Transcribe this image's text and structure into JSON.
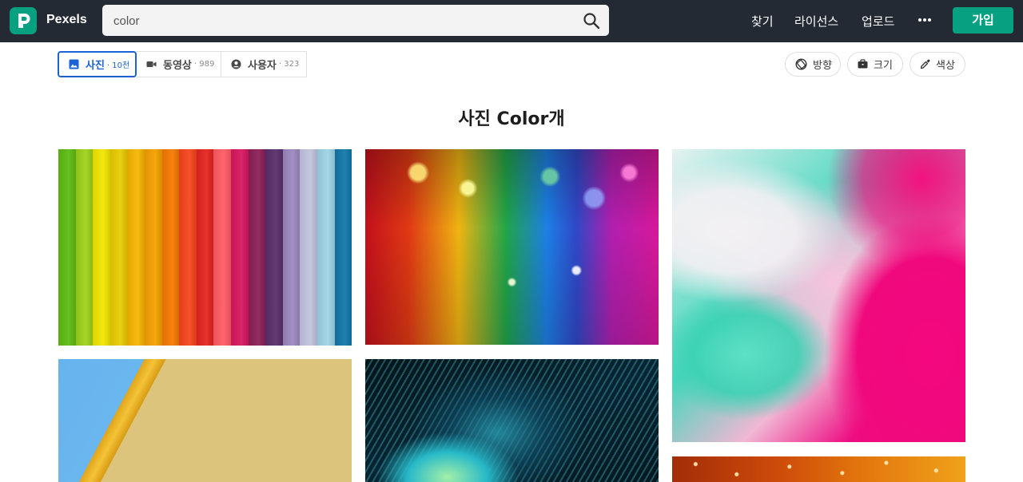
{
  "header": {
    "brand": "Pexels",
    "search": {
      "value": "color"
    },
    "nav": [
      "찾기",
      "라이선스",
      "업로드"
    ],
    "join_label": "가입"
  },
  "tabs": [
    {
      "label": "사진",
      "count": "· 10천",
      "icon": "image-icon",
      "active": true
    },
    {
      "label": "동영상",
      "count": "· 989",
      "icon": "video-camera-icon",
      "active": false
    },
    {
      "label": "사용자",
      "count": "· 323",
      "icon": "user-circle-icon",
      "active": false
    }
  ],
  "filters": [
    {
      "label": "방향",
      "icon": "orientation-icon"
    },
    {
      "label": "크기",
      "icon": "briefcase-icon"
    },
    {
      "label": "색상",
      "icon": "eyedropper-icon"
    }
  ],
  "heading": "사진 Color개",
  "colors": {
    "topbar": "#232a34",
    "brand_green": "#07a081",
    "active_tab": "#1a62d6",
    "stripes": [
      "#5dbb12",
      "#9ed219",
      "#f3e600",
      "#e9cd00",
      "#f6b600",
      "#f5a000",
      "#f57a00",
      "#f5451c",
      "#e52420",
      "#ff5b64",
      "#d8175f",
      "#8c1f58",
      "#5a2e6c",
      "#9c88bf",
      "#c2c4e0",
      "#9dd3e6",
      "#1277a9"
    ]
  },
  "photos": [
    {
      "name": "photo-rainbow-paper"
    },
    {
      "name": "photo-rainbow-glitter"
    },
    {
      "name": "photo-pink-teal-marble"
    },
    {
      "name": "photo-yellow-pencil"
    },
    {
      "name": "photo-peacock-feather"
    },
    {
      "name": "photo-orange-water-drops"
    }
  ]
}
